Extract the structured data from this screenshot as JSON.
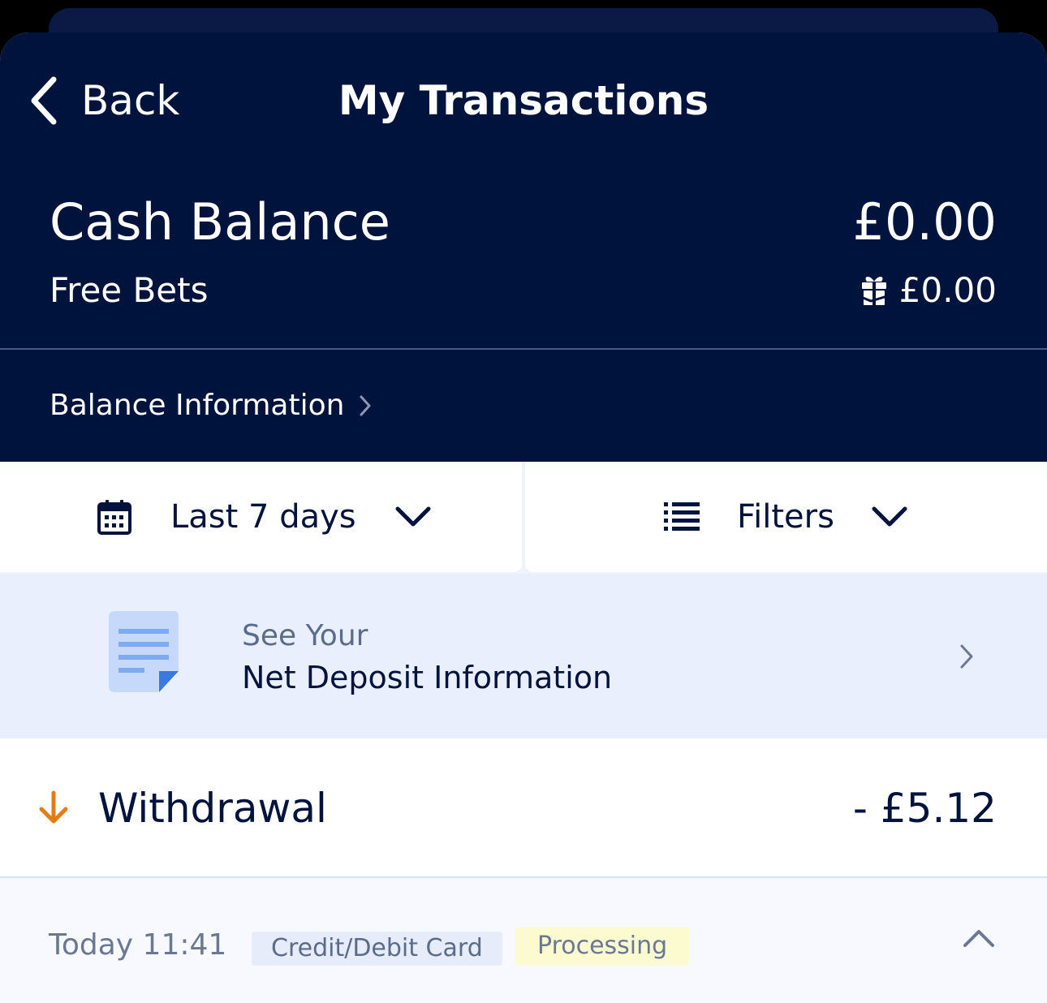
{
  "nav": {
    "back_label": "Back",
    "title": "My Transactions"
  },
  "balance": {
    "cash_label": "Cash Balance",
    "cash_value": "£0.00",
    "free_bets_label": "Free Bets",
    "free_bets_value": "£0.00",
    "info_link": "Balance Information"
  },
  "filters": {
    "date_range": "Last 7 days",
    "filters_label": "Filters"
  },
  "net_deposit": {
    "subtitle": "See Your",
    "title": "Net Deposit Information"
  },
  "transaction": {
    "type": "Withdrawal",
    "amount": "- £5.12",
    "time": "Today 11:41",
    "method": "Credit/Debit Card",
    "status": "Processing"
  },
  "colors": {
    "navy": "#00133d",
    "accent_orange": "#e57b14",
    "light_blue_bg": "#e9effd",
    "status_yellow": "#fbfbcf"
  }
}
